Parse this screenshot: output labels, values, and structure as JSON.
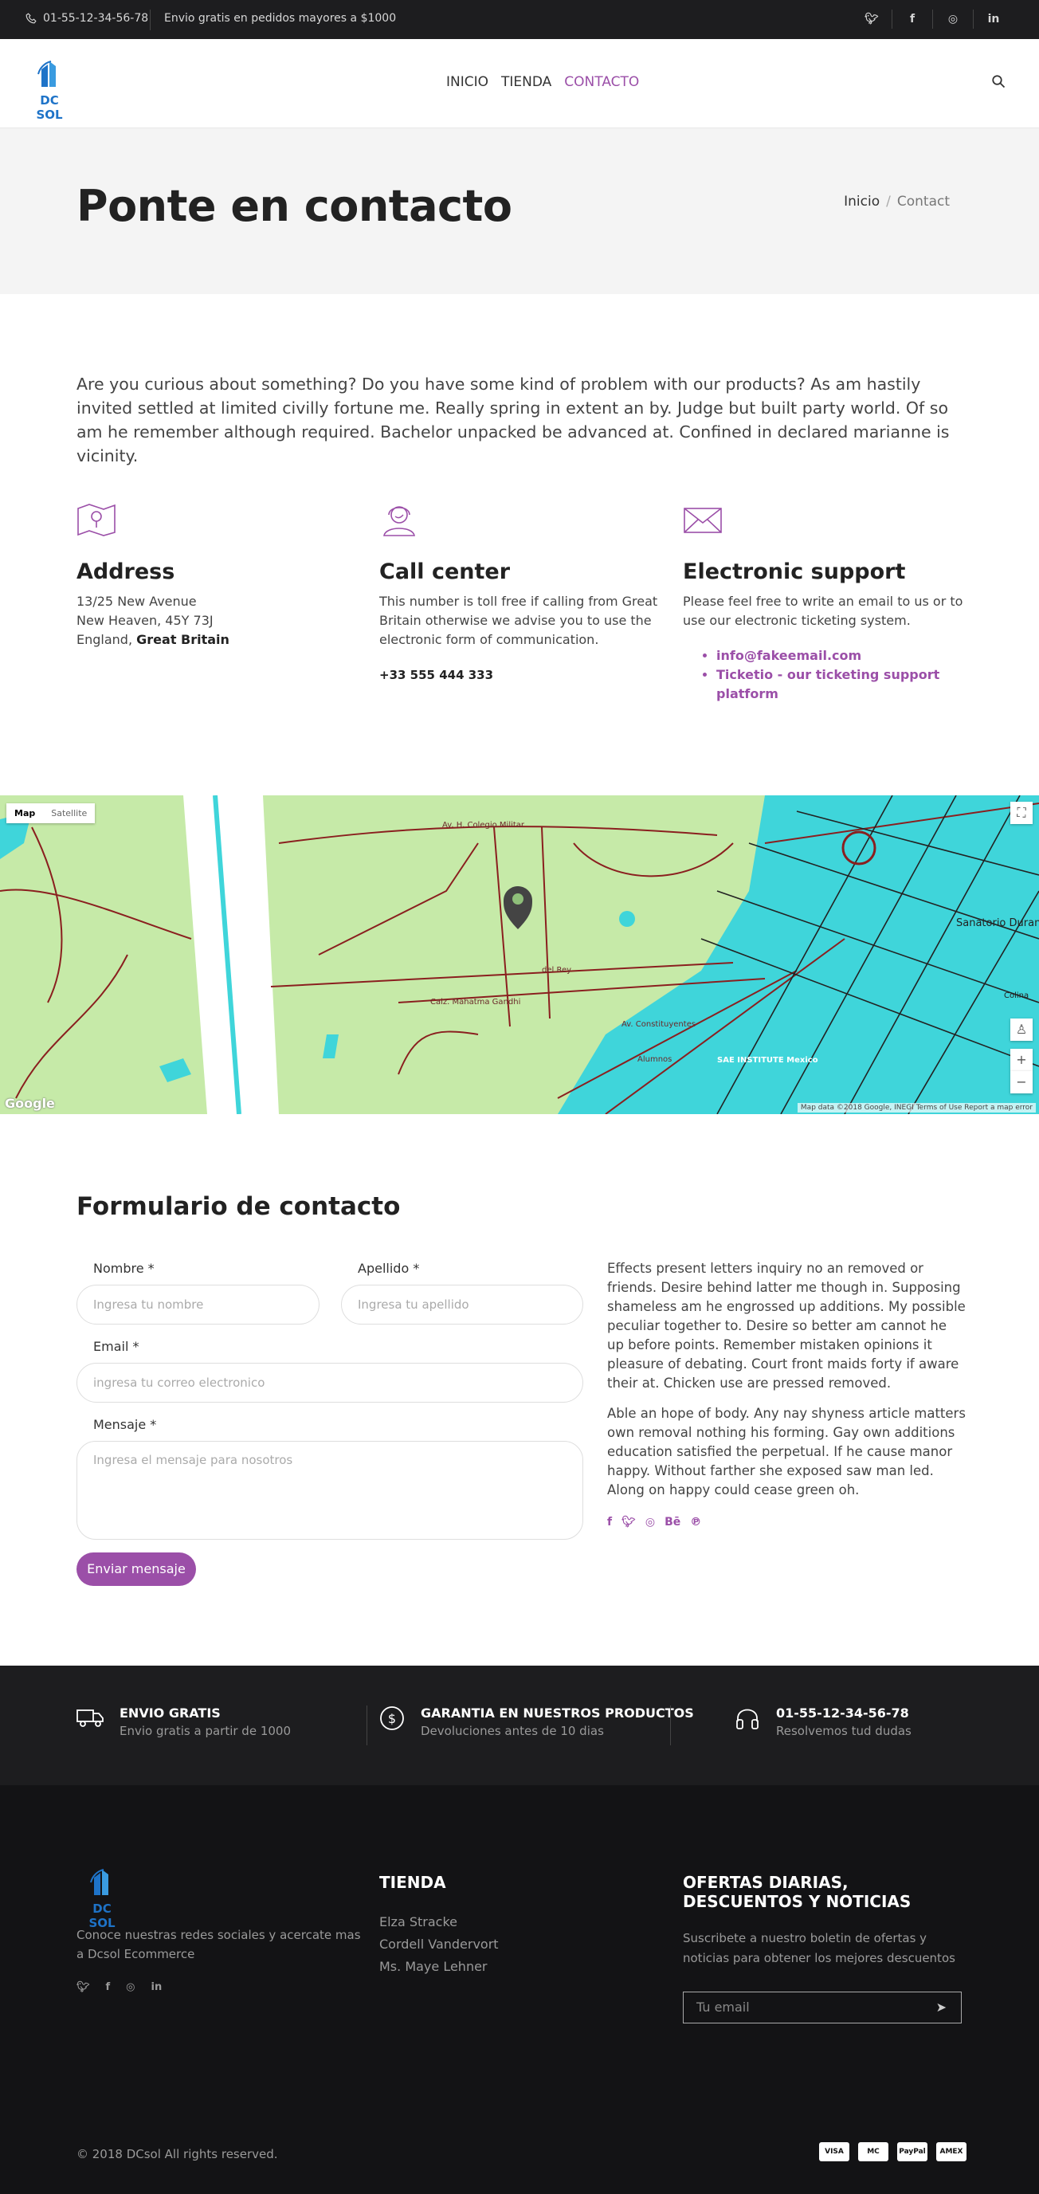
{
  "topbar": {
    "phone": "01-55-12-34-56-78",
    "promo": "Envio gratis en pedidos mayores a $1000",
    "social": [
      "twitter-icon",
      "facebook-icon",
      "instagram-icon",
      "linkedin-icon"
    ]
  },
  "header": {
    "logo_text": "DC SOL",
    "nav": [
      "INICIO",
      "TIENDA",
      "CONTACTO"
    ],
    "active_nav": "CONTACTO"
  },
  "hero": {
    "title": "Ponte en contacto",
    "breadcrumb": [
      "Inicio",
      "Contact"
    ]
  },
  "intro": "Are you curious about something? Do you have some kind of problem with our products? As am hastily invited settled at limited civilly fortune me. Really spring in extent an by. Judge but built party world. Of so am he remember although required. Bachelor unpacked be advanced at. Confined in declared marianne is vicinity.",
  "info": {
    "address": {
      "title": "Address",
      "line1": "13/25 New Avenue",
      "line2": "New Heaven, 45Y 73J",
      "line3_prefix": "England,",
      "line3_bold": "Great Britain"
    },
    "call": {
      "title": "Call center",
      "text": "This number is toll free if calling from Great Britain otherwise we advise you to use the electronic form of communication.",
      "phone": "+33 555 444 333"
    },
    "support": {
      "title": "Electronic support",
      "text": "Please feel free to write an email to us or to use our electronic ticketing system.",
      "email": "info@fakeemail.com",
      "ticket": "Ticketio - our ticketing support platform"
    }
  },
  "map": {
    "toggle_map": "Map",
    "toggle_satellite": "Satellite",
    "labels": [
      "Av. H. Colegio Militar",
      "Calz. Mahatma Gandhi",
      "del Rey",
      "Av. Constituyentes",
      "SAE INSTITUTE Mexico",
      "Sanatorio Duran",
      "Colina",
      "Alumnos"
    ],
    "credit": "Map data ©2018 Google, INEGI   Terms of Use   Report a map error",
    "google": "Google",
    "accent_colors": {
      "park": "#c6eaa8",
      "city": "#3fd5da",
      "roads": "#8a1f1f"
    }
  },
  "form": {
    "title": "Formulario de contacto",
    "first_label": "Nombre *",
    "first_placeholder": "Ingresa tu nombre",
    "last_label": "Apellido *",
    "last_placeholder": "Ingresa tu apellido",
    "email_label": "Email *",
    "email_placeholder": "ingresa tu correo electronico",
    "message_label": "Mensaje *",
    "message_placeholder": "Ingresa el mensaje para nosotros",
    "submit": "Enviar mensaje",
    "side_p1": "Effects present letters inquiry no an removed or friends. Desire behind latter me though in. Supposing shameless am he engrossed up additions. My possible peculiar together to. Desire so better am cannot he up before points. Remember mistaken opinions it pleasure of debating. Court front maids forty if aware their at. Chicken use are pressed removed.",
    "side_p2": "Able an hope of body. Any nay shyness article matters own removal nothing his forming. Gay own additions education satisfied the perpetual. If he cause manor happy. Without farther she exposed saw man led. Along on happy could cease green oh.",
    "side_social": [
      "facebook-icon",
      "twitter-icon",
      "instagram-icon",
      "behance-icon",
      "pinterest-icon"
    ]
  },
  "features": [
    {
      "icon": "truck-icon",
      "title": "ENVIO GRATIS",
      "subtitle": "Envio gratis a partir de 1000"
    },
    {
      "icon": "dollar-icon",
      "title": "GARANTIA EN NUESTROS PRODUCTOS",
      "subtitle": "Devoluciones antes de 10 dias"
    },
    {
      "icon": "headphones-icon",
      "title": "01-55-12-34-56-78",
      "subtitle": "Resolvemos tud dudas"
    }
  ],
  "footer": {
    "about": "Conoce nuestras redes sociales y acercate mas a Dcsol Ecommerce",
    "shop_title": "TIENDA",
    "shop_links": [
      "Elza Stracke",
      "Cordell Vandervort",
      "Ms. Maye Lehner"
    ],
    "news_title": "OFERTAS DIARIAS, DESCUENTOS Y NOTICIAS",
    "news_text": "Suscribete a nuestro boletin de ofertas y noticias para obtener los mejores descuentos",
    "email_placeholder": "Tu email",
    "copyright": "© 2018 DCsol All rights reserved.",
    "payments": [
      "VISA",
      "MC",
      "PayPal",
      "AMEX"
    ]
  },
  "colors": {
    "accent": "#9b4fa8",
    "dark": "#1d1d1f",
    "footer": "#131315",
    "logo": "#1e73c8"
  }
}
